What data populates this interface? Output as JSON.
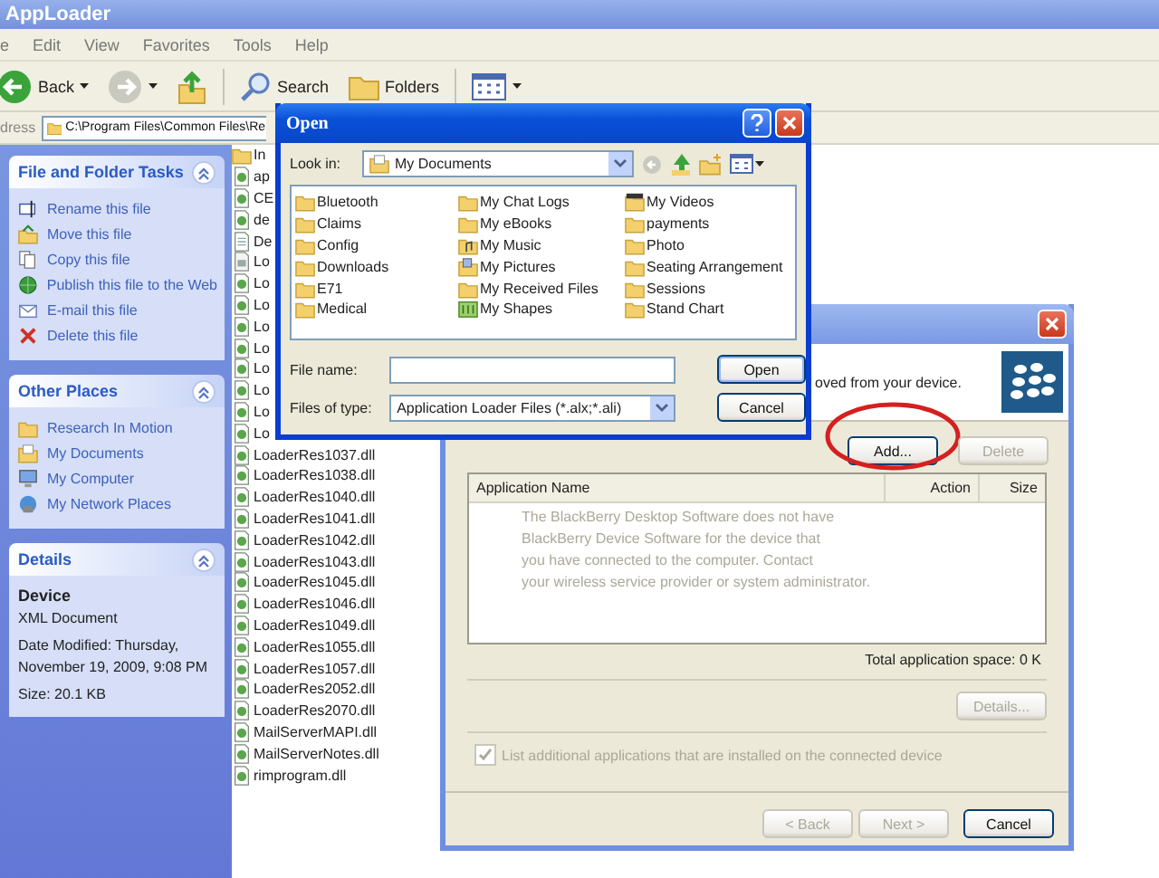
{
  "explorer": {
    "title": "AppLoader",
    "menu": [
      "e",
      "Edit",
      "View",
      "Favorites",
      "Tools",
      "Help"
    ],
    "toolbar": [
      {
        "kind": "back",
        "label": "Back"
      },
      {
        "kind": "forward"
      },
      {
        "kind": "up"
      },
      {
        "kind": "search",
        "label": "Search"
      },
      {
        "kind": "folders",
        "label": "Folders"
      },
      {
        "kind": "views"
      }
    ],
    "address": {
      "label": "dress",
      "value": "C:\\Program Files\\Common Files\\Re"
    },
    "panels": [
      {
        "kind": "tasks",
        "title": "File and Folder Tasks",
        "items": [
          {
            "kind": "rename",
            "label": "Rename this file"
          },
          {
            "kind": "move",
            "label": "Move this file"
          },
          {
            "kind": "copy",
            "label": "Copy this file"
          },
          {
            "kind": "web",
            "label": "Publish this file to the Web"
          },
          {
            "kind": "mail",
            "label": "E-mail this file"
          },
          {
            "kind": "delete",
            "label": "Delete this file"
          }
        ]
      },
      {
        "kind": "tasks",
        "title": "Other Places",
        "items": [
          {
            "kind": "folder",
            "label": "Research In Motion"
          },
          {
            "kind": "documents",
            "label": "My Documents"
          },
          {
            "kind": "computer",
            "label": "My Computer"
          },
          {
            "kind": "network",
            "label": "My Network Places"
          }
        ]
      },
      {
        "kind": "details",
        "title": "Details",
        "heading": "Device",
        "lines": [
          "XML Document",
          "Date Modified: Thursday,",
          "November 19, 2009, 9:08 PM",
          "Size: 20.1 KB"
        ]
      }
    ],
    "files": [
      {
        "kind": "folder",
        "name": "In"
      },
      {
        "kind": "dll",
        "name": "ap"
      },
      {
        "kind": "dll",
        "name": "CE"
      },
      {
        "kind": "dll",
        "name": "de"
      },
      {
        "kind": "doc",
        "name": "De"
      },
      {
        "kind": "setup",
        "name": "Lo"
      },
      {
        "kind": "dll",
        "name": "Lo"
      },
      {
        "kind": "dll",
        "name": "Lo"
      },
      {
        "kind": "dll",
        "name": "Lo"
      },
      {
        "kind": "dll",
        "name": "Lo"
      },
      {
        "kind": "dll",
        "name": "Lo"
      },
      {
        "kind": "dll",
        "name": "Lo"
      },
      {
        "kind": "dll",
        "name": "Lo"
      },
      {
        "kind": "dll",
        "name": "Lo"
      },
      {
        "kind": "dll",
        "name": "LoaderRes1037.dll"
      },
      {
        "kind": "dll",
        "name": "LoaderRes1038.dll"
      },
      {
        "kind": "dll",
        "name": "LoaderRes1040.dll"
      },
      {
        "kind": "dll",
        "name": "LoaderRes1041.dll"
      },
      {
        "kind": "dll",
        "name": "LoaderRes1042.dll"
      },
      {
        "kind": "dll",
        "name": "LoaderRes1043.dll"
      },
      {
        "kind": "dll",
        "name": "LoaderRes1045.dll"
      },
      {
        "kind": "dll",
        "name": "LoaderRes1046.dll"
      },
      {
        "kind": "dll",
        "name": "LoaderRes1049.dll"
      },
      {
        "kind": "dll",
        "name": "LoaderRes1055.dll"
      },
      {
        "kind": "dll",
        "name": "LoaderRes1057.dll"
      },
      {
        "kind": "dll",
        "name": "LoaderRes2052.dll"
      },
      {
        "kind": "dll",
        "name": "LoaderRes2070.dll"
      },
      {
        "kind": "dll",
        "name": "MailServerMAPI.dll"
      },
      {
        "kind": "dll",
        "name": "MailServerNotes.dll"
      },
      {
        "kind": "dll",
        "name": "rimprogram.dll"
      }
    ]
  },
  "open_dialog": {
    "title": "Open",
    "look_in": {
      "label": "Look in:",
      "value": "My Documents"
    },
    "items": [
      {
        "kind": "folder",
        "name": "Bluetooth"
      },
      {
        "kind": "folder",
        "name": "Claims"
      },
      {
        "kind": "folder",
        "name": "Config"
      },
      {
        "kind": "folder",
        "name": "Downloads"
      },
      {
        "kind": "folder",
        "name": "E71"
      },
      {
        "kind": "folder",
        "name": "Medical"
      },
      {
        "kind": "folder",
        "name": "My Chat Logs"
      },
      {
        "kind": "folder",
        "name": "My eBooks"
      },
      {
        "kind": "music",
        "name": "My Music"
      },
      {
        "kind": "pictures",
        "name": "My Pictures"
      },
      {
        "kind": "folder",
        "name": "My Received Files"
      },
      {
        "kind": "shapes",
        "name": "My Shapes"
      },
      {
        "kind": "videos",
        "name": "My Videos"
      },
      {
        "kind": "folder",
        "name": "payments"
      },
      {
        "kind": "folder",
        "name": "Photo"
      },
      {
        "kind": "folder",
        "name": "Seating Arrangement"
      },
      {
        "kind": "folder",
        "name": "Sessions"
      },
      {
        "kind": "folder",
        "name": "Stand Chart"
      }
    ],
    "file_name": {
      "label": "File name:"
    },
    "file_type": {
      "label": "Files of type:",
      "value": "Application Loader Files (*.alx;*.ali)"
    },
    "buttons": [
      {
        "label": "Open",
        "default": true
      },
      {
        "label": "Cancel",
        "default": false
      }
    ]
  },
  "wizard": {
    "header_text": "oved from your device.",
    "buttons": [
      {
        "label": "Add...",
        "disabled": false,
        "highlighted": true
      },
      {
        "label": "Delete",
        "disabled": true,
        "highlighted": false
      }
    ],
    "table": {
      "columns": [
        "Application Name",
        "Action",
        "Size"
      ],
      "message": [
        "The BlackBerry Desktop Software does not have",
        "BlackBerry Device Software for the device that",
        "you have connected to the computer. Contact",
        "your wireless service provider or system administrator."
      ]
    },
    "total": "Total application space:  0 K",
    "details_button": {
      "label": "Details...",
      "disabled": true
    },
    "list_additional": {
      "label": "List additional applications that are installed on the connected device",
      "checked": true,
      "disabled": true
    },
    "nav_buttons": [
      {
        "label": "< Back",
        "disabled": true
      },
      {
        "label": "Next >",
        "disabled": true
      },
      {
        "label": "Cancel",
        "disabled": false
      }
    ]
  }
}
